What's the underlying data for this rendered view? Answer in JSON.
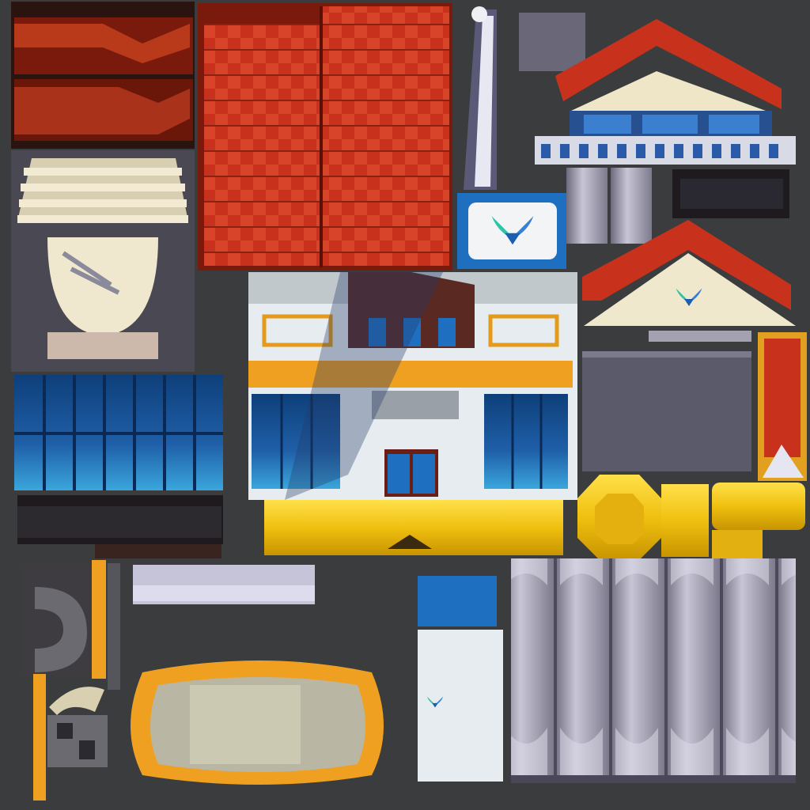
{
  "atlas": {
    "background": "#3a3c3d",
    "palette": {
      "roof_red": "#c8321c",
      "roof_dark": "#7a1a0c",
      "glass_blue": "#1f5fa8",
      "glass_light": "#3a9fd6",
      "gold": "#f0c010",
      "orange": "#f0a020",
      "cream": "#eee6c8",
      "wall_white": "#e6ecef",
      "frame_brown": "#5a2a22",
      "pillar_gray": "#9a98aa",
      "shadow": "#1e1a1e"
    },
    "emblem": "winged-bird-emblem",
    "pieces": [
      "brick-roof-tile",
      "red-roof-tile",
      "stair-lamp-tile",
      "blue-glass-window-tile",
      "dark-base-strip-tile",
      "flag-pole-tile",
      "gym-sign-panel",
      "small-house-facade",
      "small-pillars",
      "dark-panel-strip",
      "gable-emblem-roof",
      "main-gym-facade",
      "yellow-awning-band",
      "gray-wall-panel",
      "red-banner-tile",
      "gold-octagon-emblem",
      "gold-pipe-tile",
      "horseshoe-arch-tile",
      "orange-pole-strip",
      "lavender-beam",
      "orange-rim-pad",
      "blue-wing-side-panel",
      "column-curtain-wall",
      "mini-parts-cluster"
    ]
  }
}
